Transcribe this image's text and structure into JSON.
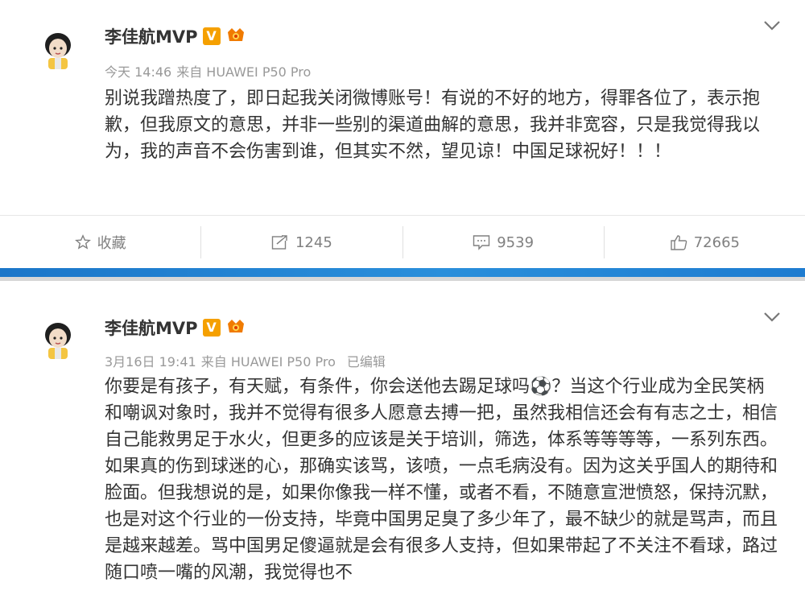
{
  "posts": [
    {
      "username": "李佳航MVP",
      "time": "今天 14:46",
      "source": "来自 HUAWEI P50 Pro",
      "edited": "",
      "text": "别说我蹭热度了，即日起我关闭微博账号！有说的不好的地方，得罪各位了，表示抱歉，但我原文的意思，并非一些别的渠道曲解的意思，我并非宽容，只是我觉得我以为，我的声音不会伤害到谁，但其实不然，望见谅！中国足球祝好！！！",
      "actions": {
        "favorite": "收藏",
        "repost": "1245",
        "comment": "9539",
        "like": "72665"
      }
    },
    {
      "username": "李佳航MVP",
      "time": "3月16日 19:41",
      "source": "来自 HUAWEI P50 Pro",
      "edited": "已编辑",
      "text": "你要是有孩子，有天赋，有条件，你会送他去踢足球吗⚽？当这个行业成为全民笑柄和嘲讽对象时，我并不觉得有很多人愿意去搏一把，虽然我相信还会有有志之士，相信自己能救男足于水火，但更多的应该是关于培训，筛选，体系等等等等，一系列东西。如果真的伤到球迷的心，那确实该骂，该喷，一点毛病没有。因为这关乎国人的期待和脸面。但我想说的是，如果你像我一样不懂，或者不看，不随意宣泄愤怒，保持沉默，也是对这个行业的一份支持，毕竟中国男足臭了多少年了，最不缺少的就是骂声，而且是越来越差。骂中国男足傻逼就是会有很多人支持，但如果带起了不关注不看球，路过随口喷一嘴的风潮，我觉得也不"
    }
  ],
  "badge_letter": "V",
  "colors": {
    "accent_blue": "#1b76c9",
    "badge_orange": "#f5a000",
    "text": "#333333",
    "meta": "#999999"
  },
  "icons": [
    "avatar",
    "verified-v-icon",
    "vip-crown-icon",
    "chevron-down-icon",
    "star-icon",
    "repost-icon",
    "comment-icon",
    "like-icon"
  ]
}
